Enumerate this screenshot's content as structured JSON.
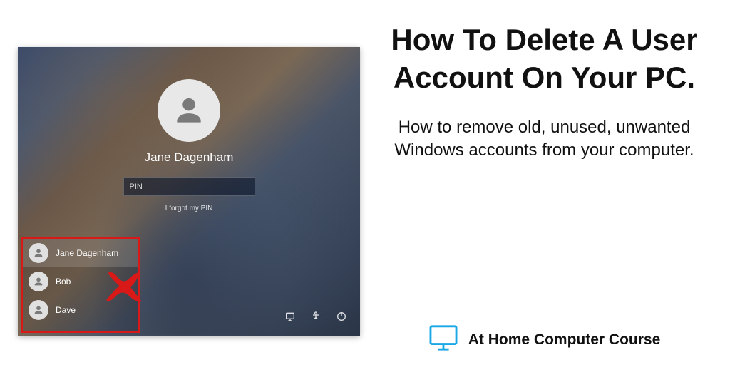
{
  "login": {
    "username": "Jane Dagenham",
    "pin_placeholder": "PIN",
    "forgot_link": "I forgot my PIN"
  },
  "user_list": {
    "items": [
      {
        "name": "Jane Dagenham",
        "selected": true
      },
      {
        "name": "Bob",
        "selected": false
      },
      {
        "name": "Dave",
        "selected": false
      }
    ]
  },
  "article": {
    "title": "How To Delete A User Account On Your PC.",
    "subtitle": "How to remove old, unused, unwanted Windows accounts from your computer."
  },
  "footer": {
    "brand": "At Home Computer Course"
  },
  "colors": {
    "highlight_box": "#d91818",
    "brand_blue": "#1aa7e6"
  }
}
